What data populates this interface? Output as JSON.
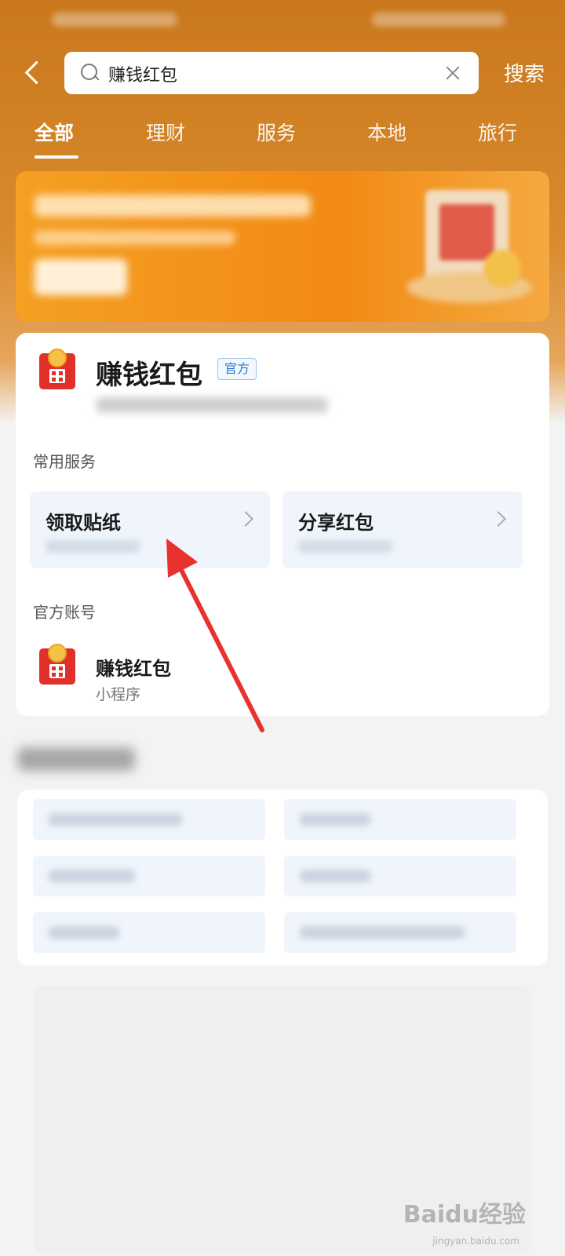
{
  "search": {
    "query": "赚钱红包",
    "button_label": "搜索"
  },
  "tabs": [
    {
      "label": "全部",
      "active": true
    },
    {
      "label": "理财",
      "active": false
    },
    {
      "label": "服务",
      "active": false
    },
    {
      "label": "本地",
      "active": false
    },
    {
      "label": "旅行",
      "active": false
    }
  ],
  "result_card": {
    "title": "赚钱红包",
    "badge": "官方",
    "common_services_label": "常用服务",
    "services": [
      {
        "label": "领取贴纸"
      },
      {
        "label": "分享红包"
      }
    ],
    "official_account_label": "官方账号",
    "account": {
      "name": "赚钱红包",
      "type": "小程序"
    }
  },
  "watermark": {
    "text": "Baidu经验",
    "url_text": "jingyan.baidu.com"
  },
  "colors": {
    "header_orange": "#d88a2c",
    "banner_orange": "#f28a13",
    "annotation_red": "#e8322f",
    "badge_blue": "#2a77c9"
  }
}
